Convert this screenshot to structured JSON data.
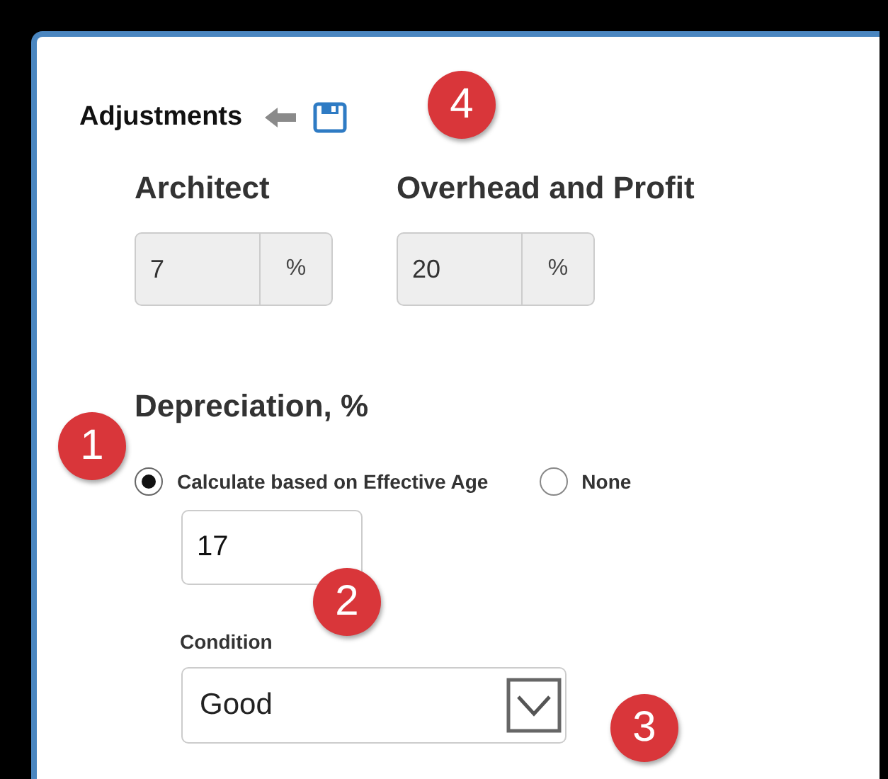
{
  "panel": {
    "title": "Adjustments"
  },
  "fees": [
    {
      "label": "Architect",
      "value": "7",
      "unit": "%"
    },
    {
      "label": "Overhead and Profit",
      "value": "20",
      "unit": "%"
    }
  ],
  "depreciation": {
    "heading": "Depreciation, %",
    "options": [
      {
        "label": "Calculate based on Effective Age",
        "selected": true
      },
      {
        "label": "None",
        "selected": false
      }
    ],
    "effective_age": "17",
    "condition": {
      "label": "Condition",
      "value": "Good"
    }
  },
  "callouts": [
    {
      "number": "1",
      "kind": "depreciation"
    },
    {
      "number": "2",
      "kind": "age"
    },
    {
      "number": "3",
      "kind": "condition"
    },
    {
      "number": "4",
      "kind": "title"
    }
  ]
}
